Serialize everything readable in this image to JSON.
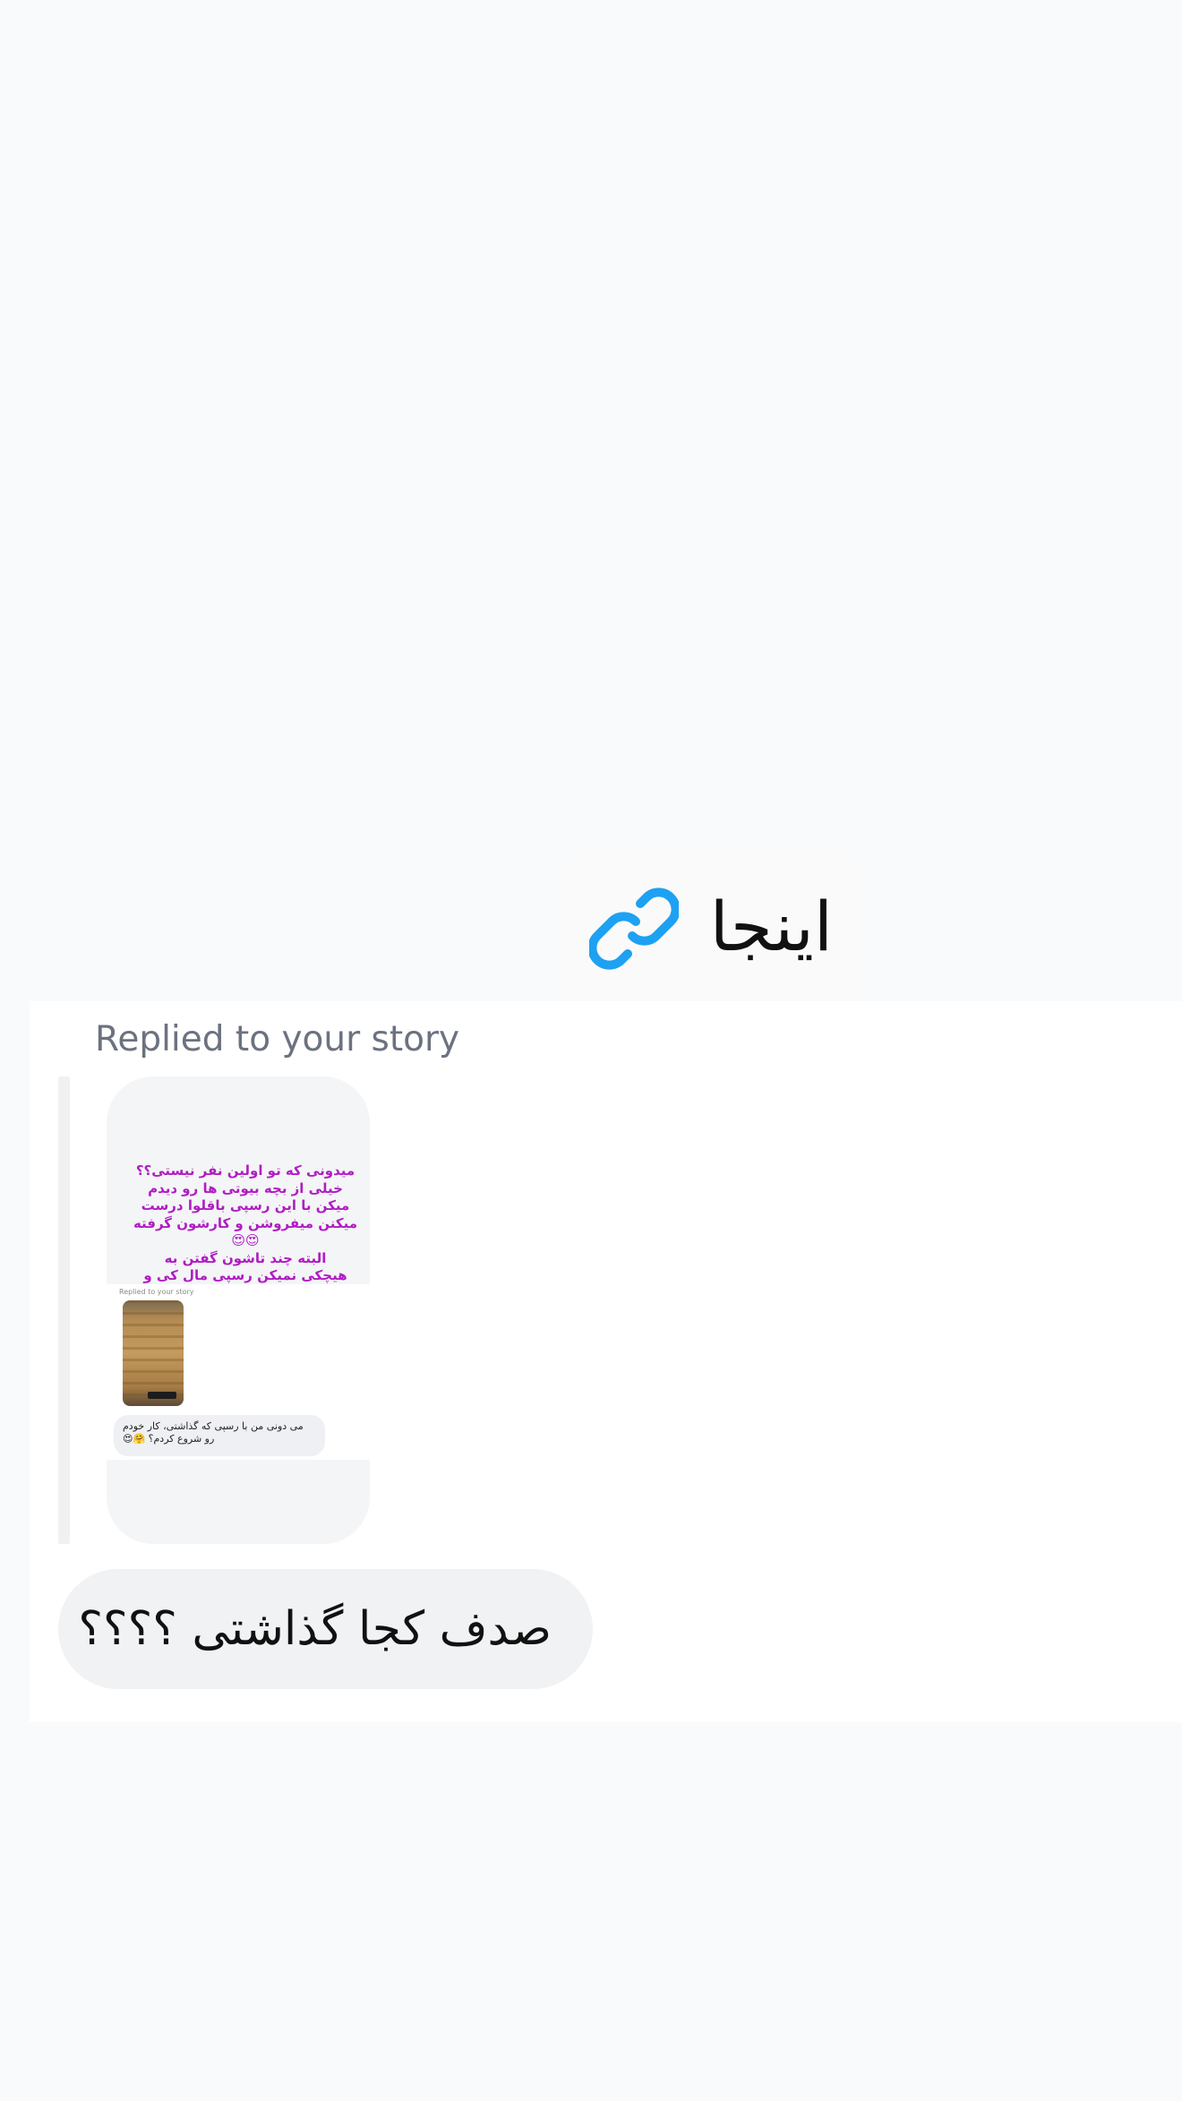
{
  "link_message": {
    "text": "اینجا",
    "icon": "link-icon",
    "icon_color": "#1da1f2"
  },
  "reply_header": {
    "label": "Replied to your story"
  },
  "story_preview": {
    "text": "میدونی که تو اولین نفر نیستی؟؟\nخیلی از بچه بیوتی ها رو دیدم\nمیکن با این رسپی باقلوا درست\nمیکنن میفروشن و کارشون گرفته\n😍😍\nالبته چند تاشون گفتن به\nهیچکی نمیکن رسپی مال کی و\nکجاست🤔",
    "text_color": "#b01dc2",
    "embedded_screenshot": {
      "replied_label": "Replied to your story",
      "bubble_text": "می دونی من با رسپی که گذاشتی، کار خودم رو شروع کردم؟ 🤗😍"
    }
  },
  "reply_message": {
    "text": "صدف کجا گذاشتی ؟؟؟؟"
  }
}
